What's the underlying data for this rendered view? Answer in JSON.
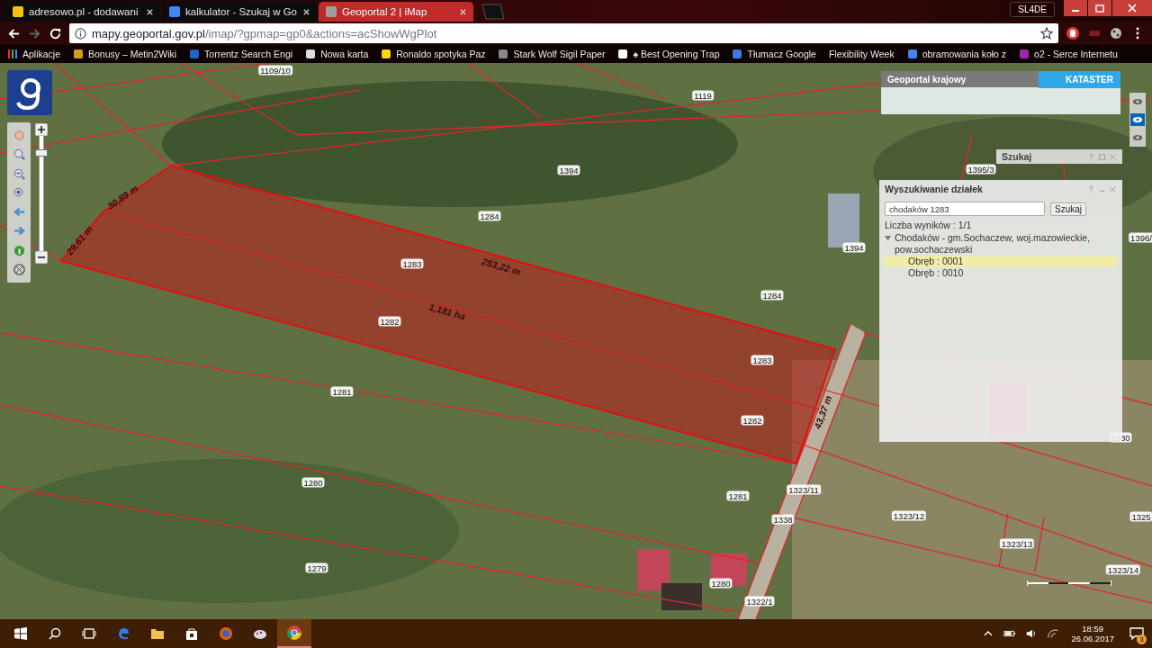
{
  "browser": {
    "tabs": [
      {
        "title": "adresowo.pl - dodawani",
        "selected": false
      },
      {
        "title": "kalkulator - Szukaj w Go",
        "selected": false
      },
      {
        "title": "Geoportal 2 | iMap",
        "selected": true
      }
    ],
    "profile": "SL4DE",
    "address": {
      "host": "mapy.geoportal.gov.pl",
      "path": "/imap/?gpmap=gp0&actions=acShowWgPlot"
    },
    "bookmarks": [
      "Aplikacje",
      "Bonusy – Metin2Wiki",
      "Torrentz Search Engi",
      "Nowa karta",
      "Ronaldo spotyka Paz",
      "Stark Wolf Sigil Paper",
      "♠ Best Opening Trap",
      "Tłumacz Google",
      "Flexibility Week",
      "obramowania koło z",
      "o2 - Serce Internetu"
    ]
  },
  "map": {
    "zoom": {
      "level": 0.85
    },
    "parcels": [
      "1109/10",
      "1119",
      "1394",
      "1284",
      "1283",
      "1282",
      "1284",
      "1394",
      "1395/3",
      "1396/",
      "1283",
      "1282",
      "1281",
      "1280",
      "1281",
      "1279",
      "1280",
      "1338",
      "1323/11",
      "1323/12",
      "1323/13",
      "1325",
      "1323/14",
      "1330",
      "1322/1"
    ],
    "measurements": [
      "253,22 m",
      "1,181 ha",
      "43,37 m",
      "30,89 m",
      "29,61 m"
    ],
    "layers": [
      {
        "selected": false
      },
      {
        "selected": true
      },
      {
        "selected": false
      }
    ],
    "banner": {
      "title": "Geoportal krajowy",
      "badge": "KATASTER"
    },
    "search_window": {
      "title": "Szukaj"
    },
    "parcel_search": {
      "title": "Wyszukiwanie działek",
      "query": "chodaków 1283",
      "button": "Szukaj",
      "result_count": "Liczba wyników : 1/1",
      "results": [
        {
          "label": "Chodaków - gm.Sochaczew, woj.mazowieckie, pow.sochaczewski",
          "expanded": true,
          "children": [
            {
              "label": "Obręb : 0001",
              "selected": true
            },
            {
              "label": "Obręb : 0010",
              "selected": false
            }
          ]
        }
      ]
    }
  },
  "taskbar": {
    "time": "18:59",
    "date": "26.06.2017",
    "notifications": "3"
  }
}
